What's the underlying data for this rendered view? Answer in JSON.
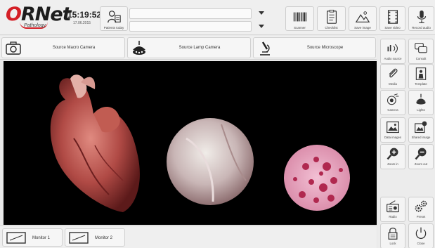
{
  "header": {
    "logo": {
      "main_o": "O",
      "main_rest": "RNet",
      "sub": "Pathology"
    },
    "time": "15:19:52",
    "date": "17.06.2015",
    "patients_today_label": "Patients today",
    "patient_field_1": "",
    "patient_field_2": "",
    "buttons": {
      "scanner": "Scanner",
      "checklist": "Checklist",
      "save_image": "Save image",
      "save_video": "Save video",
      "record_audio": "Record audio"
    }
  },
  "sources": [
    {
      "label": "Source Macro Camera",
      "icon": "camera-icon"
    },
    {
      "label": "Source Lamp Camera",
      "icon": "lamp-camera-icon"
    },
    {
      "label": "Source Microscope",
      "icon": "microscope-icon"
    }
  ],
  "right_panel": {
    "audio_source": "Audio source",
    "consult": "Consult",
    "media": "Media",
    "template": "Template",
    "camera": "Camera",
    "lights": "Lights",
    "data_images": "Data images",
    "shared_image": "Shared image",
    "zoom_in": "Zoom in",
    "zoom_out": "Zoom out",
    "radio": "Radio",
    "preset": "Preset",
    "lock": "Lock",
    "close": "Close"
  },
  "monitors": [
    {
      "label": "Monitor 1"
    },
    {
      "label": "Monitor 2"
    }
  ],
  "colors": {
    "brand_red": "#d41f26",
    "video_background": "#000000",
    "panel_background": "#efefef"
  }
}
